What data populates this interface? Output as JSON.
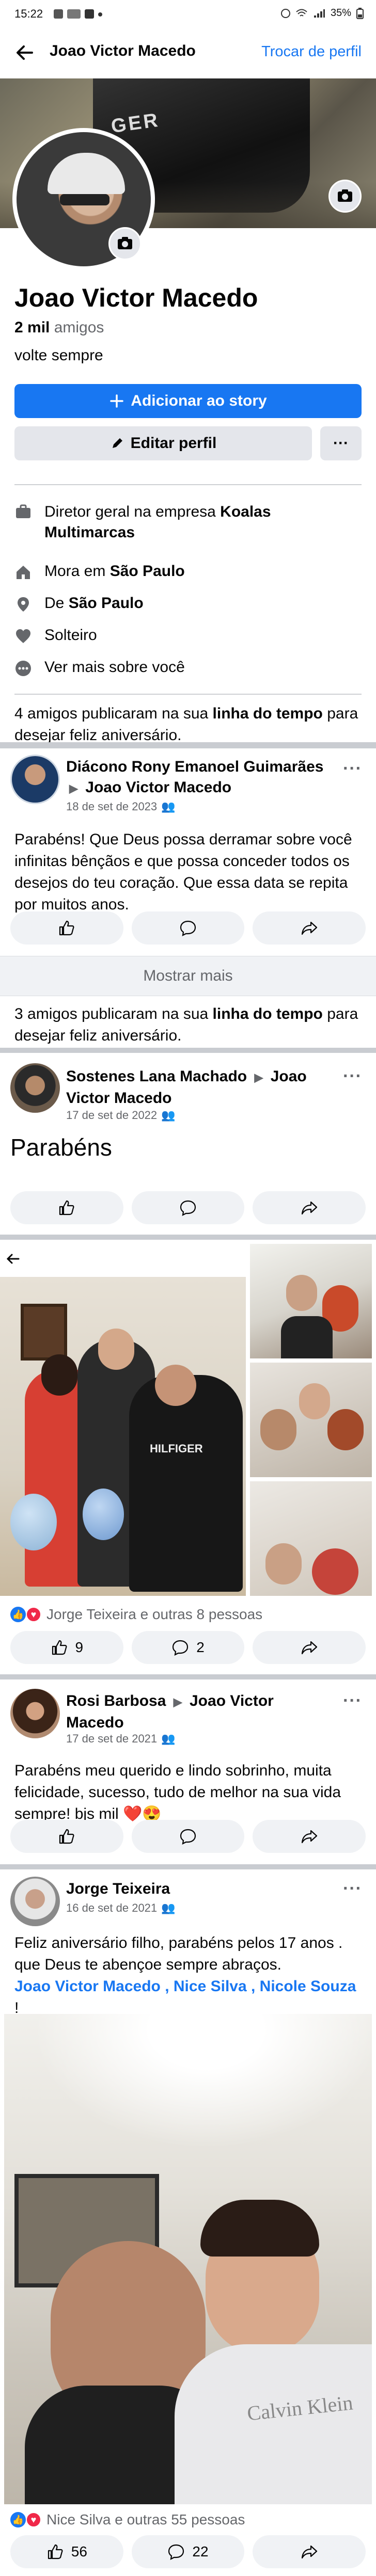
{
  "status_bar": {
    "time": "15:22",
    "right": "35%"
  },
  "appbar": {
    "title": "Joao Victor Macedo",
    "action": "Trocar de perfil"
  },
  "cover": {
    "shirt_text": "GER"
  },
  "profile": {
    "name": "Joao Victor Macedo",
    "friends_count": "2 mil",
    "friends_word": "amigos",
    "bio": "volte sempre",
    "add_story_label": "Adicionar ao story",
    "edit_profile_label": "Editar perfil",
    "more_label": "···"
  },
  "intro": {
    "job_prefix": "Diretor geral na empresa ",
    "job_company": "Koalas Multimarcas",
    "lives_prefix": "Mora em ",
    "lives_city": "São Paulo",
    "from_prefix": "De ",
    "from_city": "São Paulo",
    "relationship": "Solteiro",
    "see_more": "Ver mais sobre você"
  },
  "notice1": {
    "prefix": "4 amigos publicaram na sua ",
    "bold": "linha do tempo",
    "suffix": " para desejar feliz aniversário."
  },
  "post1": {
    "author": "Diácono Rony Emanoel Guimarães",
    "arrow": "▶",
    "target": "Joao Victor Macedo",
    "date": "18 de set de 2023",
    "text": "Parabéns! Que Deus possa derramar sobre você infinitas bênçãos e que possa conceder todos os desejos do teu coração. Que essa data se repita por muitos anos."
  },
  "show_more_label": "Mostrar mais",
  "notice2": {
    "prefix": "3 amigos publicaram na sua ",
    "bold": "linha do tempo",
    "suffix": " para desejar feliz aniversário."
  },
  "post2": {
    "author": "Sostenes Lana Machado",
    "arrow": "▶",
    "target": "Joao Victor Macedo",
    "date": "17 de set de 2022",
    "text": "Parabéns"
  },
  "photo_post": {
    "shirt_text": "HILFIGER",
    "reactions_text": "Jorge Teixeira e outras 8 pessoas",
    "likes": "9",
    "comments": "2"
  },
  "post3": {
    "author": "Rosi Barbosa",
    "arrow": "▶",
    "target": "Joao Victor Macedo",
    "date": "17 de set de 2021",
    "text": "Parabéns meu querido e lindo sobrinho, muita felicidade, sucesso, tudo de melhor na sua vida sempre! bjs mil ❤️😍"
  },
  "post4": {
    "author": "Jorge Teixeira",
    "date": "16 de set de 2021",
    "text": "Feliz aniversário filho, parabéns pelos 17 anos . que Deus te abençoe sempre abraços.",
    "tag1": "Joao Victor Macedo",
    "tag2": "Nice Silva",
    "tag3": "Nicole Souza",
    "sep": " , ",
    "end": " !",
    "shirt_text": "Calvin Klein",
    "reactions_text": "Nice Silva e outras 55 pessoas",
    "likes": "56",
    "comments": "22"
  },
  "icons": {
    "back": "arrow-left-icon",
    "camera": "camera-icon",
    "plus": "plus-icon",
    "pencil": "pencil-icon",
    "briefcase": "briefcase-icon",
    "home": "home-icon",
    "location": "location-pin-icon",
    "heart": "heart-icon",
    "more": "more-dots-icon",
    "like": "thumbs-up-icon",
    "comment": "comment-bubble-icon",
    "share": "share-arrow-icon",
    "globe_friends": "audience-friends-icon"
  },
  "colors": {
    "brand": "#1877f2",
    "secondary_bg": "#e4e6eb",
    "band": "#c9ccd1",
    "meta": "#65676b"
  }
}
